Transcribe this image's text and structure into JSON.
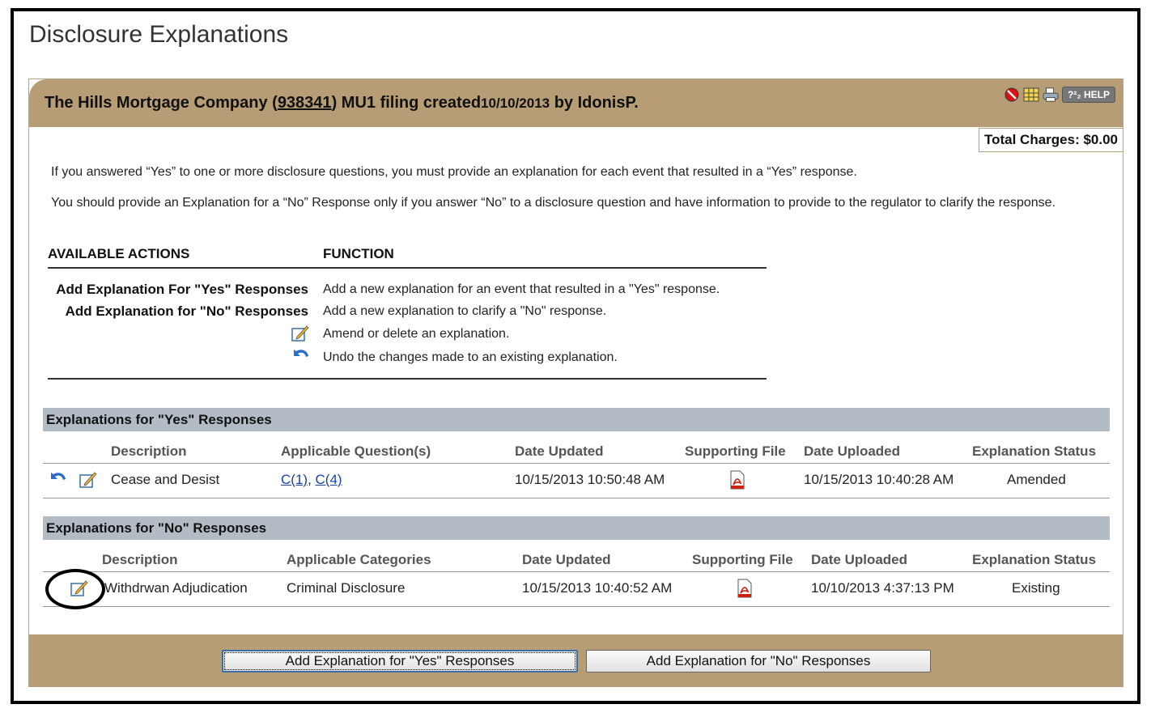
{
  "page_title": "Disclosure Explanations",
  "header": {
    "company": "The Hills Mortgage Company (",
    "company_id": "938341",
    "filing": ") MU1 filing created",
    "created_date": "10/10/2013",
    "by_user": " by IdonisP.",
    "help_label": "?²₂ HELP",
    "icons": [
      "no-entry-icon",
      "grid-icon",
      "printer-icon",
      "help-icon"
    ]
  },
  "total_charges": "Total Charges: $0.00",
  "instructions": {
    "yes_text": "If you answered “Yes” to one or more disclosure questions, you must provide an explanation for each event that resulted in a “Yes” response.",
    "no_text": "You should provide an Explanation for a “No” Response only if you answer “No” to a disclosure question and have information to provide to the regulator to clarify the response."
  },
  "actions": {
    "col_actions": "AVAILABLE ACTIONS",
    "col_function": "FUNCTION",
    "rows": [
      {
        "action": "Add Explanation For \"Yes\" Responses",
        "function": "Add a new explanation for an event that resulted in a \"Yes\" response."
      },
      {
        "action": "Add Explanation for \"No\" Responses",
        "function": "Add a new explanation to clarify a \"No\" response."
      },
      {
        "action": "edit-icon",
        "function": "Amend or delete an explanation."
      },
      {
        "action": "undo-icon",
        "function": "Undo the changes made to an existing explanation."
      }
    ]
  },
  "yes_section": {
    "title": "Explanations for \"Yes\" Responses",
    "columns": [
      "Description",
      "Applicable Question(s)",
      "Date Updated",
      "Supporting File",
      "Date Uploaded",
      "Explanation Status"
    ],
    "rows": [
      {
        "description": "Cease and Desist",
        "question1": "C(1)",
        "sep": ", ",
        "question2": "C(4)",
        "date_updated": "10/15/2013 10:50:48 AM",
        "date_uploaded": "10/15/2013 10:40:28 AM",
        "status": "Amended"
      }
    ]
  },
  "no_section": {
    "title": "Explanations for \"No\" Responses",
    "columns": [
      "Description",
      "Applicable Categories",
      "Date Updated",
      "Supporting File",
      "Date Uploaded",
      "Explanation Status"
    ],
    "rows": [
      {
        "description": "Withdrwan Adjudication",
        "category": "Criminal Disclosure",
        "date_updated": "10/15/2013 10:40:52 AM",
        "date_uploaded": "10/10/2013 4:37:13 PM",
        "status": "Existing"
      }
    ]
  },
  "buttons": {
    "add_yes": "Add Explanation for \"Yes\" Responses",
    "add_no": "Add Explanation for \"No\" Responses"
  }
}
